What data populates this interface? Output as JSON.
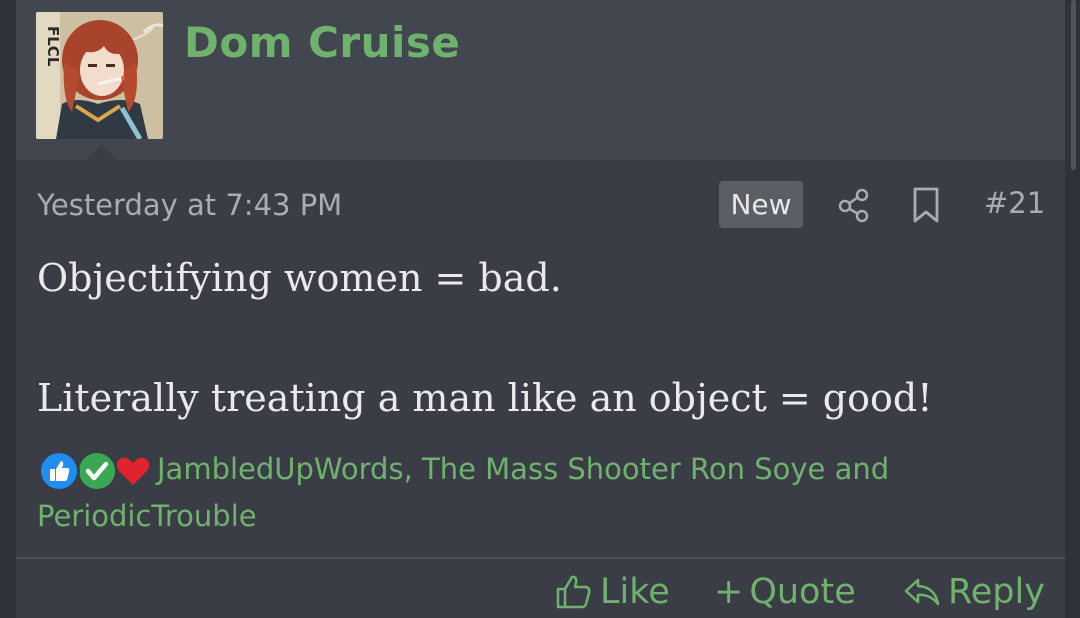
{
  "post": {
    "username": "Dom Cruise",
    "avatar_text": "FLCL",
    "date": "Yesterday at 7:43 PM",
    "new_badge": "New",
    "post_number": "#21",
    "body": {
      "line1": "Objectifying women = bad.",
      "line2": "Literally treating a man like an object = good!"
    },
    "reactions": {
      "icons": [
        "like-reaction-icon",
        "agree-reaction-icon",
        "love-reaction-icon"
      ],
      "users_line1": "JambledUpWords, The Mass Shooter Ron Soye and",
      "users_line2": "PeriodicTrouble"
    },
    "actions": {
      "like": "Like",
      "quote": "Quote",
      "reply": "Reply"
    }
  },
  "colors": {
    "accent_green": "#6fb26d",
    "background": "#3a3d45",
    "header_background": "#42464e",
    "text": "#e9eaec",
    "muted": "#a9acb2"
  }
}
